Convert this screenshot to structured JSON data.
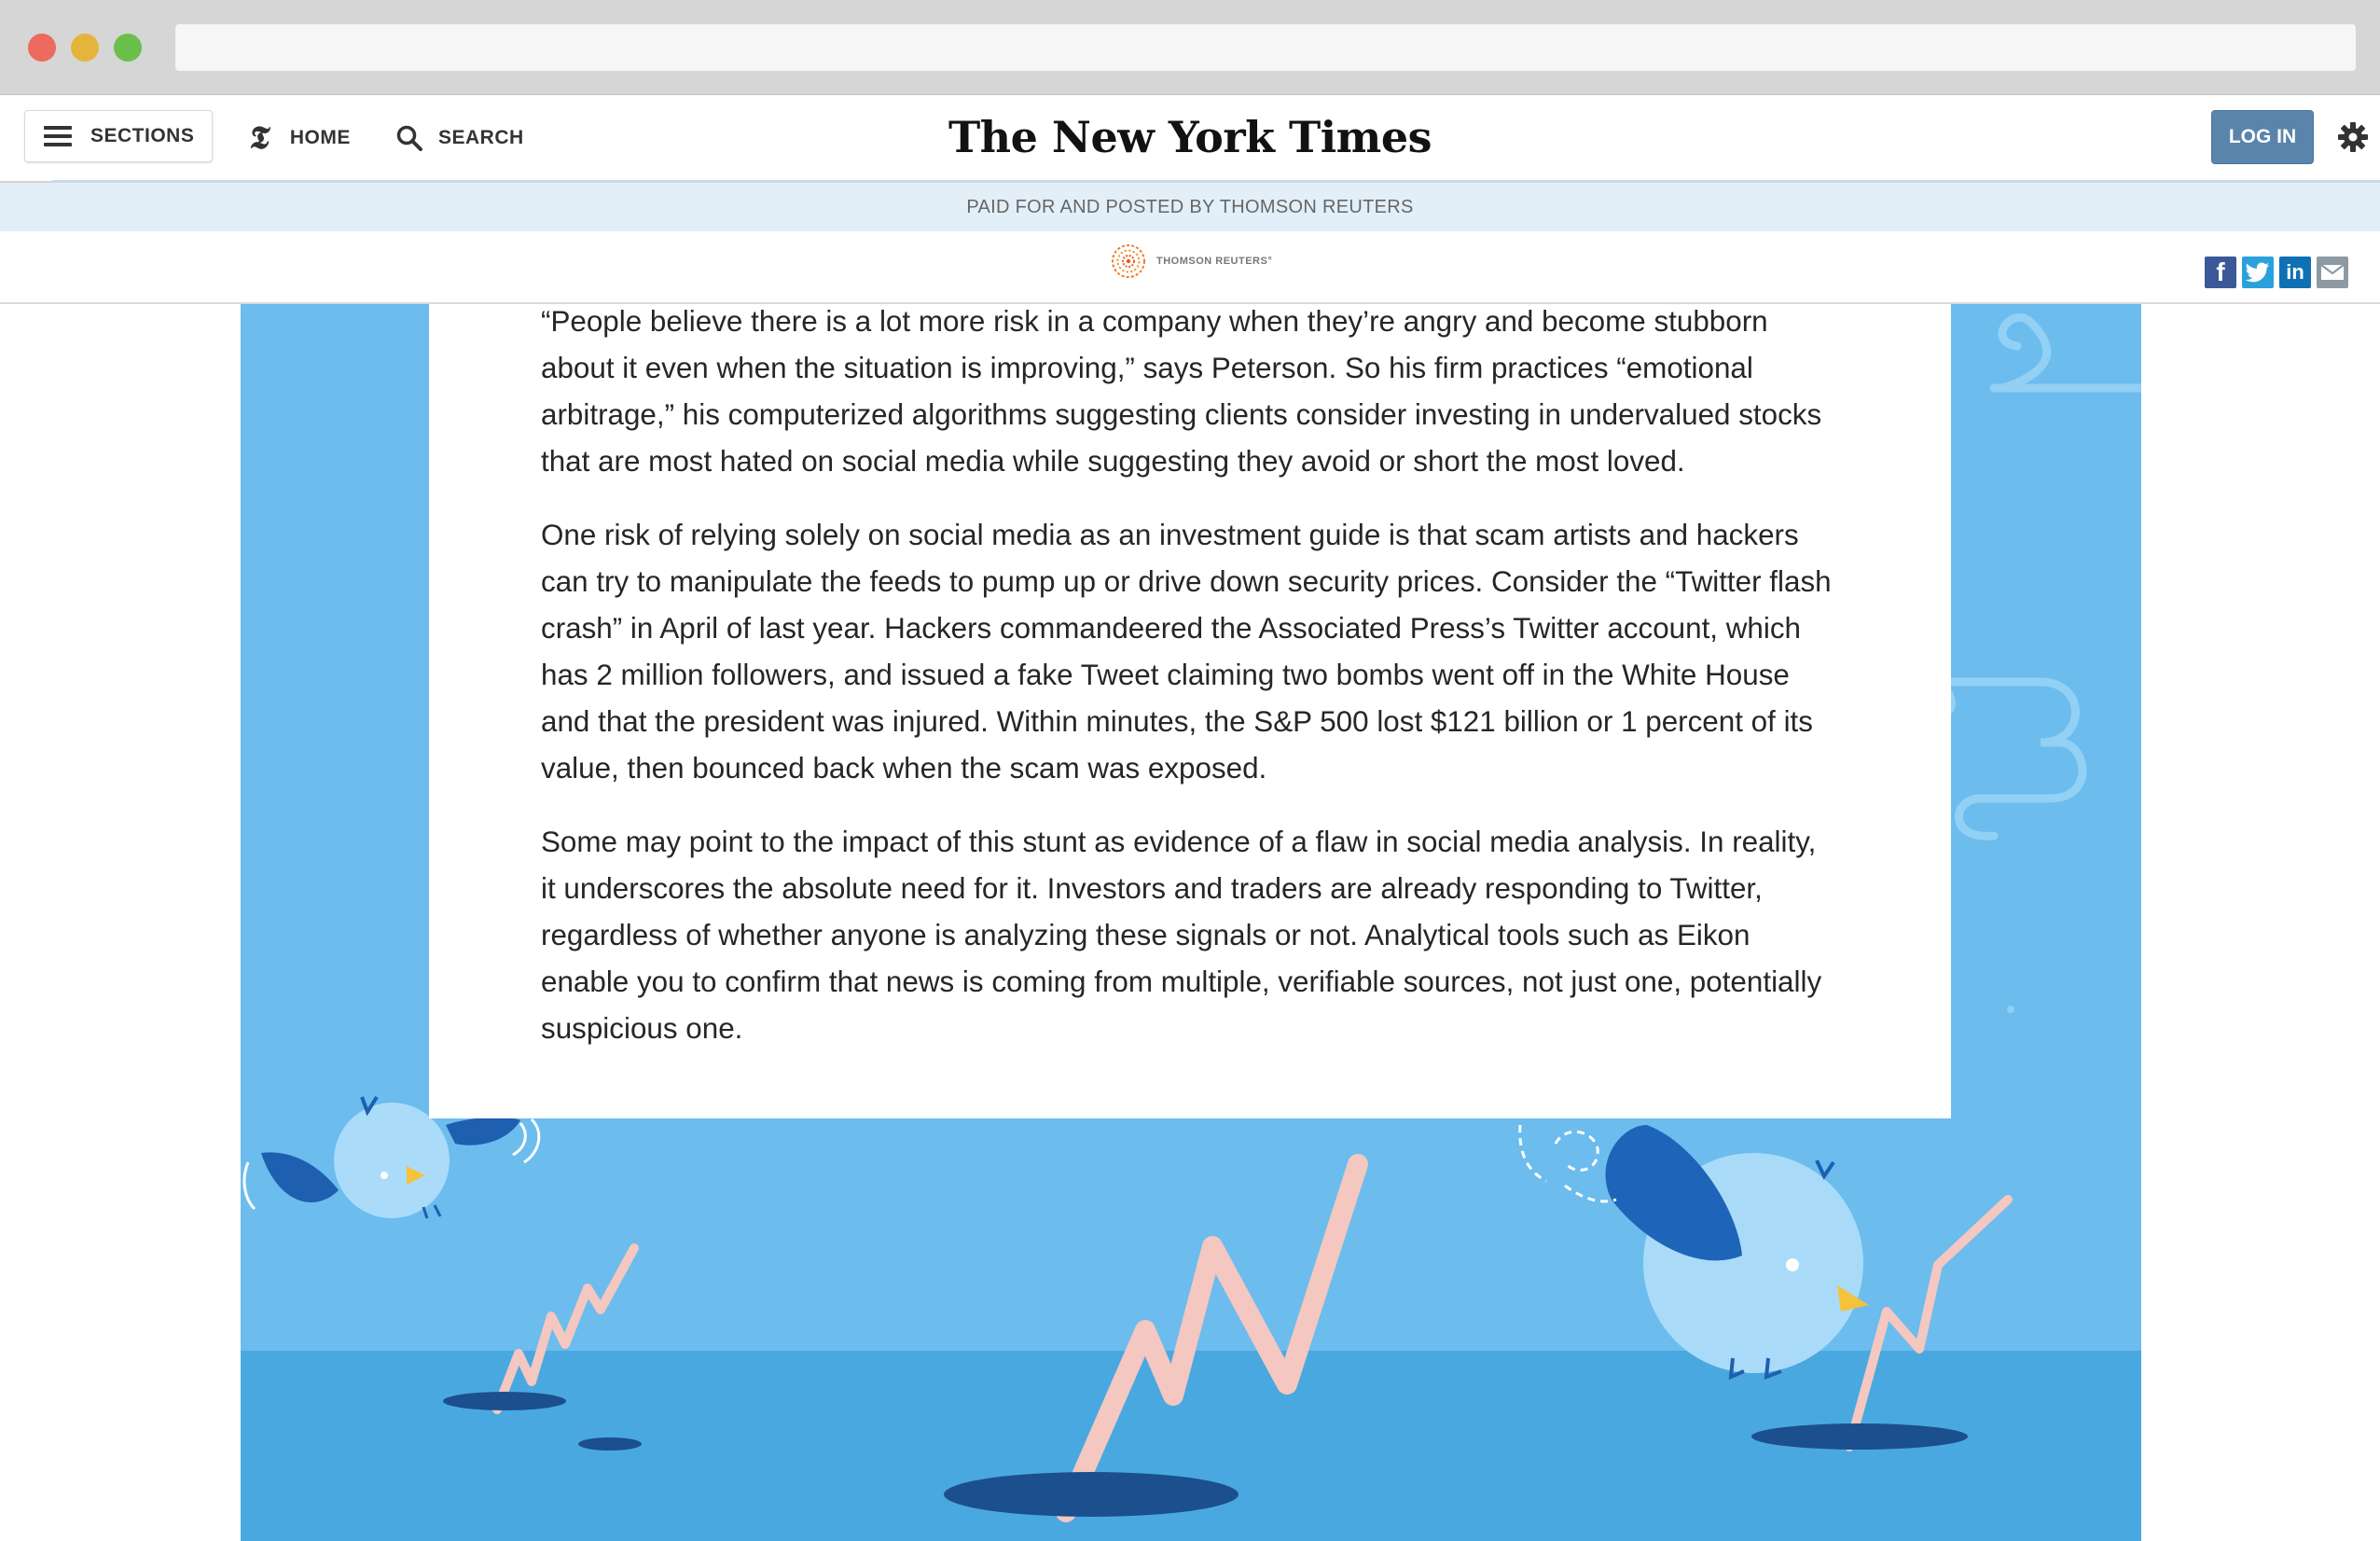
{
  "site": {
    "masthead": "The New York Times",
    "nav": {
      "sections_label": "SECTIONS",
      "home_label": "HOME",
      "search_label": "SEARCH",
      "login_label": "LOG IN"
    }
  },
  "sponsor": {
    "paid_label": "PAID FOR AND POSTED BY THOMSON REUTERS",
    "logo_text": "THOMSON REUTERS°"
  },
  "share": {
    "icons": [
      "facebook-icon",
      "twitter-icon",
      "linkedin-icon",
      "email-icon"
    ]
  },
  "article": {
    "paragraphs": [
      "“People believe there is a lot more risk in a company when they’re angry and become stubborn about it even when the situation is improving,” says Peterson. So his firm practices “emotional arbitrage,” his computerized algorithms suggesting clients consider investing in undervalued stocks that are most hated on social media while suggesting they avoid or short the most loved.",
      "One risk of relying solely on social media as an investment guide is that scam artists and hackers can try to manipulate the feeds to pump up or drive down security prices. Consider the “Twitter flash crash” in April of last year. Hackers commandeered the Associated Press’s Twitter account, which has 2 million followers, and issued a fake Tweet claiming two bombs went off in the White House and that the president was injured. Within minutes, the S&P 500 lost $121 billion or 1 percent of its value, then bounced back when the scam was exposed.",
      "Some may point to the impact of this stunt as evidence of a flaw in social media analysis. In reality, it underscores the absolute need for it. Investors and traders are already responding to Twitter, regardless of whether anyone is analyzing these signals or not. Analytical tools such as Eikon enable you to confirm that news is coming from multiple, verifiable sources, not just one, potentially suspicious one."
    ]
  },
  "colors": {
    "hero_sky": "#6cbcee",
    "hero_ground": "#4aa8e0",
    "login_button": "#5a84ab",
    "paid_bar": "#e2eff9"
  }
}
